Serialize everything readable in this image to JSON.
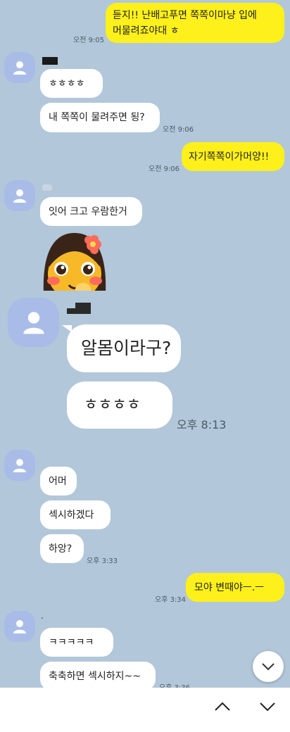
{
  "messages": {
    "m1": {
      "text": "듣지!! 난배고푸면 쪽쪽이마냥 입에\n머물려죠야대 ㅎ",
      "time": "오전 9:05"
    },
    "m2": {
      "text": "ㅎㅎㅎㅎ"
    },
    "m3": {
      "text": "내 쪽쪽이 물려주면 됭?",
      "time": "오전 9:06"
    },
    "m4": {
      "text": "자기쪽쪽이가머양!!",
      "time": "오전 9:06"
    },
    "m5": {
      "text": "잇어 크고 우람한거"
    },
    "m6": {
      "text": "알몸이라구?"
    },
    "m7": {
      "text": "ㅎㅎㅎㅎ",
      "time": "오후 8:13"
    },
    "m8": {
      "text": "어머"
    },
    "m9": {
      "text": "섹시하겠다"
    },
    "m10": {
      "text": "하앙?",
      "time": "오후 3:33"
    },
    "m11": {
      "text": "모야 변때야ㅡ.ㅡ",
      "time": "오후 3:34"
    },
    "m12": {
      "text": "ㅋㅋㅋㅋㅋ"
    },
    "m13": {
      "text": "축축하면 섹시하지~~",
      "time": "오후 3:36"
    }
  },
  "senders": {
    "s4": {
      "name": "."
    }
  },
  "icons": {
    "avatar": "person-icon",
    "emoticon": "girl-emoji-sticker",
    "scroll": "chevron-down-icon",
    "prev": "chevron-up-icon",
    "next": "chevron-down-icon"
  },
  "colors": {
    "background": "#b2c7d9",
    "my_bubble": "#fef01b",
    "their_bubble": "#ffffff",
    "avatar": "#a9bce8"
  }
}
